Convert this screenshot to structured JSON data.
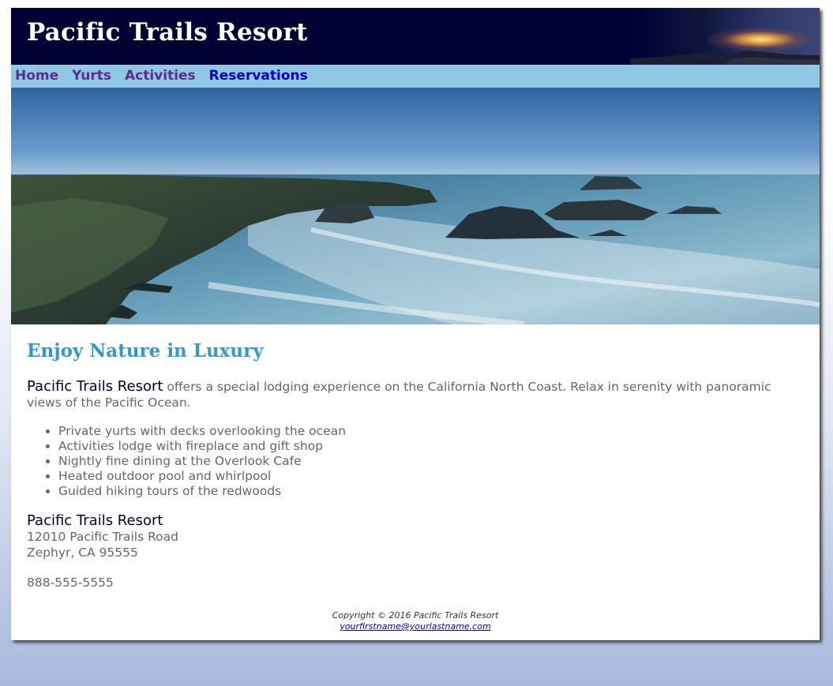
{
  "header": {
    "title": "Pacific Trails Resort"
  },
  "nav": {
    "items": [
      {
        "label": "Home"
      },
      {
        "label": "Yurts"
      },
      {
        "label": "Activities"
      },
      {
        "label": "Reservations"
      }
    ]
  },
  "main": {
    "heading": "Enjoy Nature in Luxury",
    "intro_brand": "Pacific Trails Resort",
    "intro_text": " offers a special lodging experience on the California North Coast. Relax in serenity with panoramic views of the Pacific Ocean.",
    "features": [
      "Private yurts with decks overlooking the ocean",
      "Activities lodge with fireplace and gift shop",
      "Nightly fine dining at the Overlook Cafe",
      "Heated outdoor pool and whirlpool",
      "Guided hiking tours of the redwoods"
    ],
    "contact": {
      "name": "Pacific Trails Resort",
      "street": "12010 Pacific Trails Road",
      "city": "Zephyr, CA 95555",
      "phone": "888-555-5555"
    }
  },
  "footer": {
    "copyright": "Copyright © 2016 Pacific Trails Resort",
    "email": "yourfirstname@yourlastname.com"
  },
  "colors": {
    "header_bg": "#000033",
    "nav_bg": "#90C7E3",
    "nav_link": "#5C2D91",
    "nav_link_active": "#0000CC",
    "heading": "#3399CC",
    "body_text": "#666666"
  },
  "icons": {
    "header_image": "sunset-over-coast",
    "hero_image": "rocky-pacific-coastline"
  }
}
